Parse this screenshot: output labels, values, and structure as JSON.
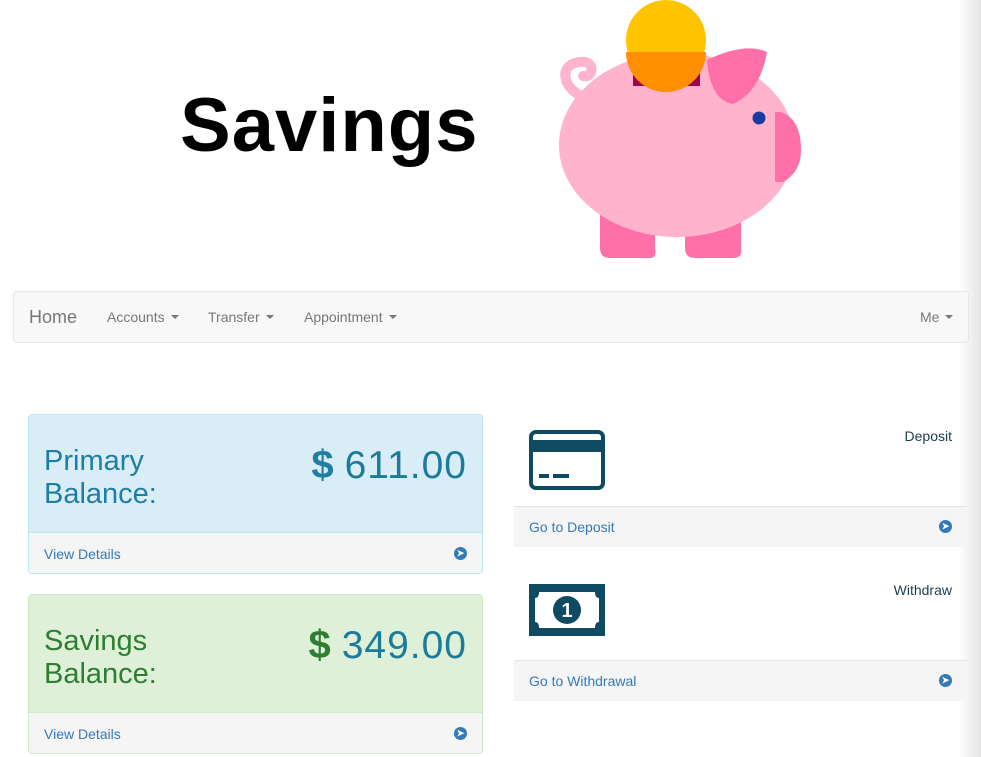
{
  "header": {
    "title": "Savings",
    "logo_icon": "piggy-bank-icon"
  },
  "navbar": {
    "brand": "Home",
    "items": [
      {
        "label": "Accounts",
        "has_dropdown": true
      },
      {
        "label": "Transfer",
        "has_dropdown": true
      },
      {
        "label": "Appointment",
        "has_dropdown": true
      }
    ],
    "right_item": {
      "label": "Me",
      "has_dropdown": true
    }
  },
  "balances": {
    "primary": {
      "label": "Primary Balance:",
      "currency": "$",
      "amount": "611.00",
      "link": "View Details",
      "color": "#d9edf7"
    },
    "savings": {
      "label": "Savings Balance:",
      "currency": "$",
      "amount": "349.00",
      "link": "View Details",
      "color": "#dff0d8"
    }
  },
  "actions": {
    "deposit": {
      "title": "Deposit",
      "link": "Go to Deposit",
      "icon": "credit-card-icon"
    },
    "withdraw": {
      "title": "Withdraw",
      "link": "Go to Withdrawal",
      "icon": "money-bill-icon"
    }
  },
  "colors": {
    "link": "#337ab7",
    "icon_dark": "#0f4a63",
    "pig_pink": "#ffb3cc",
    "coin": "#ffc400"
  }
}
